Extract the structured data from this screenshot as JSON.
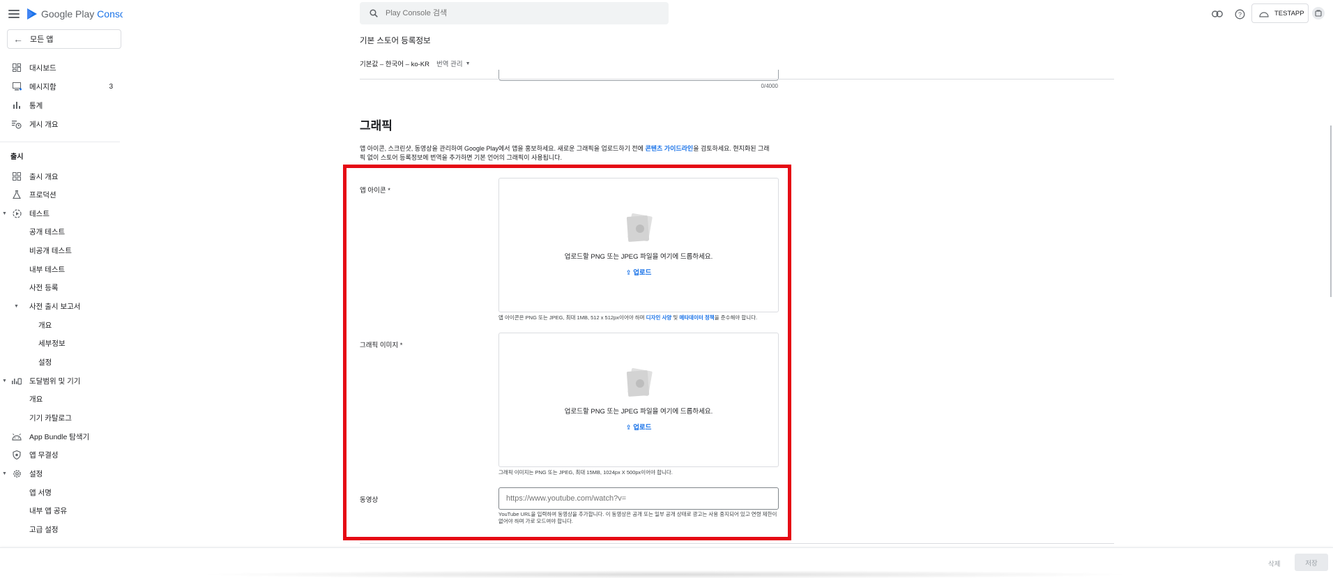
{
  "app": {
    "logo_prefix": "Google Play",
    "logo_suffix": "Console",
    "brand_color": "#1a73e8"
  },
  "sidebar": {
    "all_apps": "모든 앱",
    "items": [
      {
        "label": "대시보드",
        "icon": "dashboard-icon"
      },
      {
        "label": "메시지함",
        "icon": "inbox-icon",
        "count": "3"
      },
      {
        "label": "통계",
        "icon": "bar-chart-icon"
      },
      {
        "label": "게시 개요",
        "icon": "history-icon"
      }
    ],
    "release_section": "출시",
    "release_items": [
      {
        "label": "출시 개요",
        "icon": "grid-icon"
      },
      {
        "label": "프로덕션",
        "icon": "flask-icon"
      },
      {
        "label": "테스트",
        "icon": "play-circle-icon"
      },
      {
        "label": "공개 테스트"
      },
      {
        "label": "비공개 테스트"
      },
      {
        "label": "내부 테스트"
      },
      {
        "label": "사전 등록"
      },
      {
        "label": "사전 출시 보고서"
      },
      {
        "label": "개요"
      },
      {
        "label": "세부정보"
      },
      {
        "label": "설정"
      },
      {
        "label": "도달범위 및 기기",
        "icon": "reach-icon"
      },
      {
        "label": "개요"
      },
      {
        "label": "기기 카탈로그"
      },
      {
        "label": "App Bundle 탐색기",
        "icon": "android-icon"
      },
      {
        "label": "앱 무결성",
        "icon": "shield-icon"
      },
      {
        "label": "설정",
        "icon": "gear-icon"
      },
      {
        "label": "앱 서명"
      },
      {
        "label": "내부 앱 공유"
      },
      {
        "label": "고급 설정"
      }
    ]
  },
  "topbar": {
    "search_placeholder": "Play Console 검색",
    "app_name": "TESTAPP"
  },
  "main": {
    "page_title": "기본 스토어 등록정보",
    "default_language": "기본값 – 한국어 – ko-KR",
    "translation_menu": "번역 관리",
    "char_count": "0/4000",
    "graphics_title": "그래픽",
    "graphics_desc_1": "앱 아이콘, 스크린샷, 동영상을 관리하여 Google Play에서 앱을 홍보하세요. 새로운 그래픽을 업로드하기 전에 ",
    "graphics_desc_link": "콘텐츠 가이드라인",
    "graphics_desc_2": "을 검토하세요. 현지화된 그래픽 없이 스토어 등록정보에 번역을 추가하면 기본 언어의 그래픽이 사용됩니다.",
    "app_icon_label": "앱 아이콘 *",
    "feature_graphic_label": "그래픽 이미지 *",
    "video_label": "동영상",
    "drop_text": "업로드할 PNG 또는 JPEG 파일을 여기에 드롭하세요.",
    "upload_label": "업로드",
    "icon_hint_1": "앱 아이콘은 PNG 또는 JPEG, 최대 1MB, 512 x 512px이어야 하며 ",
    "icon_hint_link1": "디자인 사양",
    "icon_hint_mid": " 및 ",
    "icon_hint_link2": "메타데이터 정책",
    "icon_hint_2": "을 준수해야 합니다.",
    "feature_hint": "그래픽 이미지는 PNG 또는 JPEG, 최대 15MB, 1024px X 500px이어야 합니다.",
    "video_placeholder": "https://www.youtube.com/watch?v=",
    "video_hint": "YouTube URL을 입력하여 동영상을 추가합니다. 이 동영상은 공개 또는 일부 공개 상태로 광고는 사용 중지되어 있고 연령 제한이 없어야 하며 가로 모드여야 합니다."
  },
  "footer": {
    "delete_label": "삭제",
    "save_label": "저장"
  },
  "colors": {
    "highlight": "#e50914",
    "link": "#1a73e8"
  }
}
